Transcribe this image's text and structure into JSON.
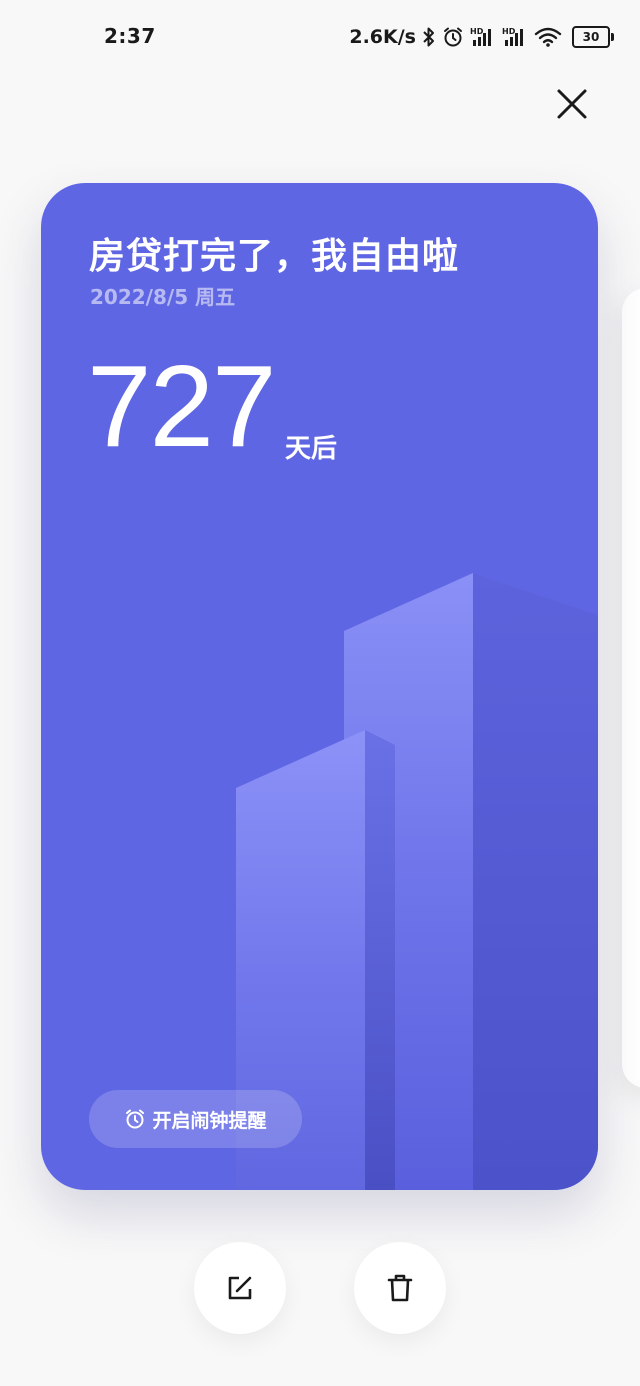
{
  "status_bar": {
    "time": "2:37",
    "net_speed": "2.6K/s",
    "battery": "30",
    "icons": [
      "bluetooth-icon",
      "alarm-icon",
      "hd-signal-icon",
      "hd-signal-icon",
      "wifi-icon",
      "battery-icon"
    ]
  },
  "close": {
    "icon": "close-icon"
  },
  "card": {
    "title": "房贷打完了，我自由啦",
    "date": "2022/8/5 周五",
    "count": "727",
    "unit": "天后",
    "alarm_label": "开启闹钟提醒",
    "alarm_icon": "alarm-clock-icon",
    "colors": {
      "background": "#5f66e3",
      "building_light": "#8a90f6",
      "building_dark": "#4b50c6"
    }
  },
  "actions": {
    "edit_icon": "edit-icon",
    "delete_icon": "trash-icon"
  }
}
